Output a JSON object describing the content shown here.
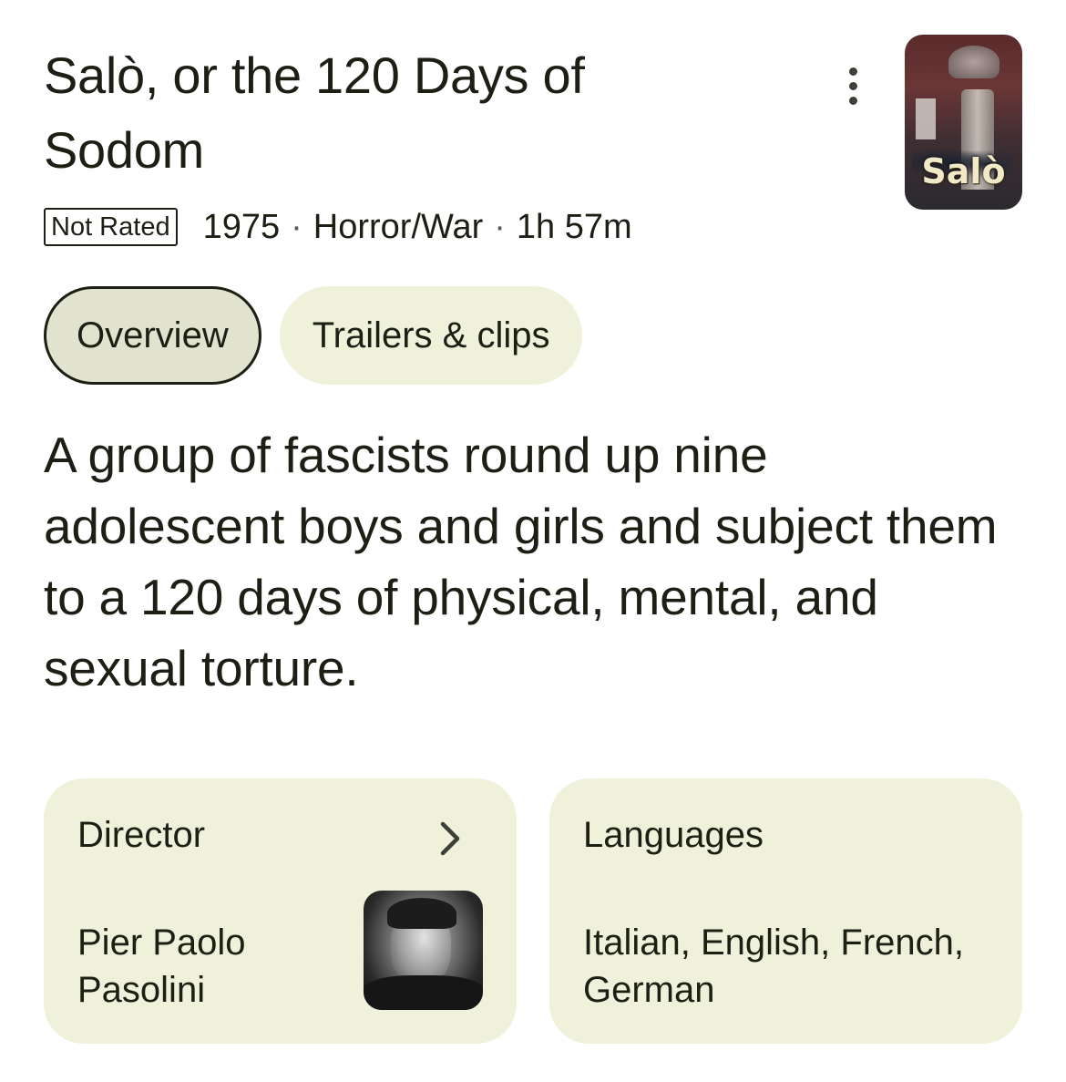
{
  "title": "Salò, or the 120 Days of Sodom",
  "poster": {
    "logo_text": "Salò",
    "alt": "Salò poster"
  },
  "meta": {
    "rating": "Not Rated",
    "year": "1975",
    "genre": "Horror/War",
    "runtime": "1h 57m",
    "separator": "·"
  },
  "tabs": [
    {
      "label": "Overview",
      "active": true
    },
    {
      "label": "Trailers & clips",
      "active": false
    }
  ],
  "synopsis": "A group of fascists round up nine adolescent boys and girls and subject them to a 120 days of physical, mental, and sexual torture.",
  "cards": {
    "director": {
      "label": "Director",
      "value": "Pier Paolo Pasolini",
      "icon": "chevron-right-icon"
    },
    "languages": {
      "label": "Languages",
      "value": "Italian, English, French, German"
    }
  },
  "icons": {
    "more": "more-vert-icon"
  },
  "colors": {
    "text": "#1d1f14",
    "chip_bg": "#eff1da",
    "chip_active_bg": "#e1e3cf"
  }
}
